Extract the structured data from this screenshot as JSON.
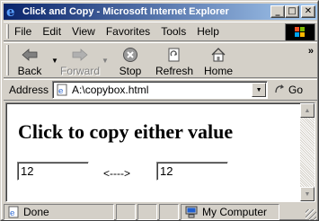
{
  "window": {
    "title": "Click and Copy - Microsoft Internet Explorer",
    "minimize_label": "_",
    "maximize_label": "□",
    "close_label": "✕"
  },
  "menu": {
    "items": [
      "File",
      "Edit",
      "View",
      "Favorites",
      "Tools",
      "Help"
    ]
  },
  "toolbar": {
    "back_label": "Back",
    "forward_label": "Forward",
    "stop_label": "Stop",
    "refresh_label": "Refresh",
    "home_label": "Home",
    "more_label": "»"
  },
  "address": {
    "label": "Address",
    "url": "A:\\copybox.html",
    "go_label": "Go"
  },
  "page": {
    "heading": "Click to copy either value",
    "field1_value": "12",
    "arrow_text": "<---->",
    "field2_value": "12"
  },
  "status": {
    "text": "Done",
    "zone": "My Computer"
  },
  "icons": {
    "ie": "ie-logo-icon",
    "back": "back-arrow-icon",
    "forward": "forward-arrow-icon",
    "stop": "stop-icon",
    "refresh": "refresh-icon",
    "home": "home-icon",
    "go": "go-arrow-icon",
    "computer": "computer-icon"
  }
}
